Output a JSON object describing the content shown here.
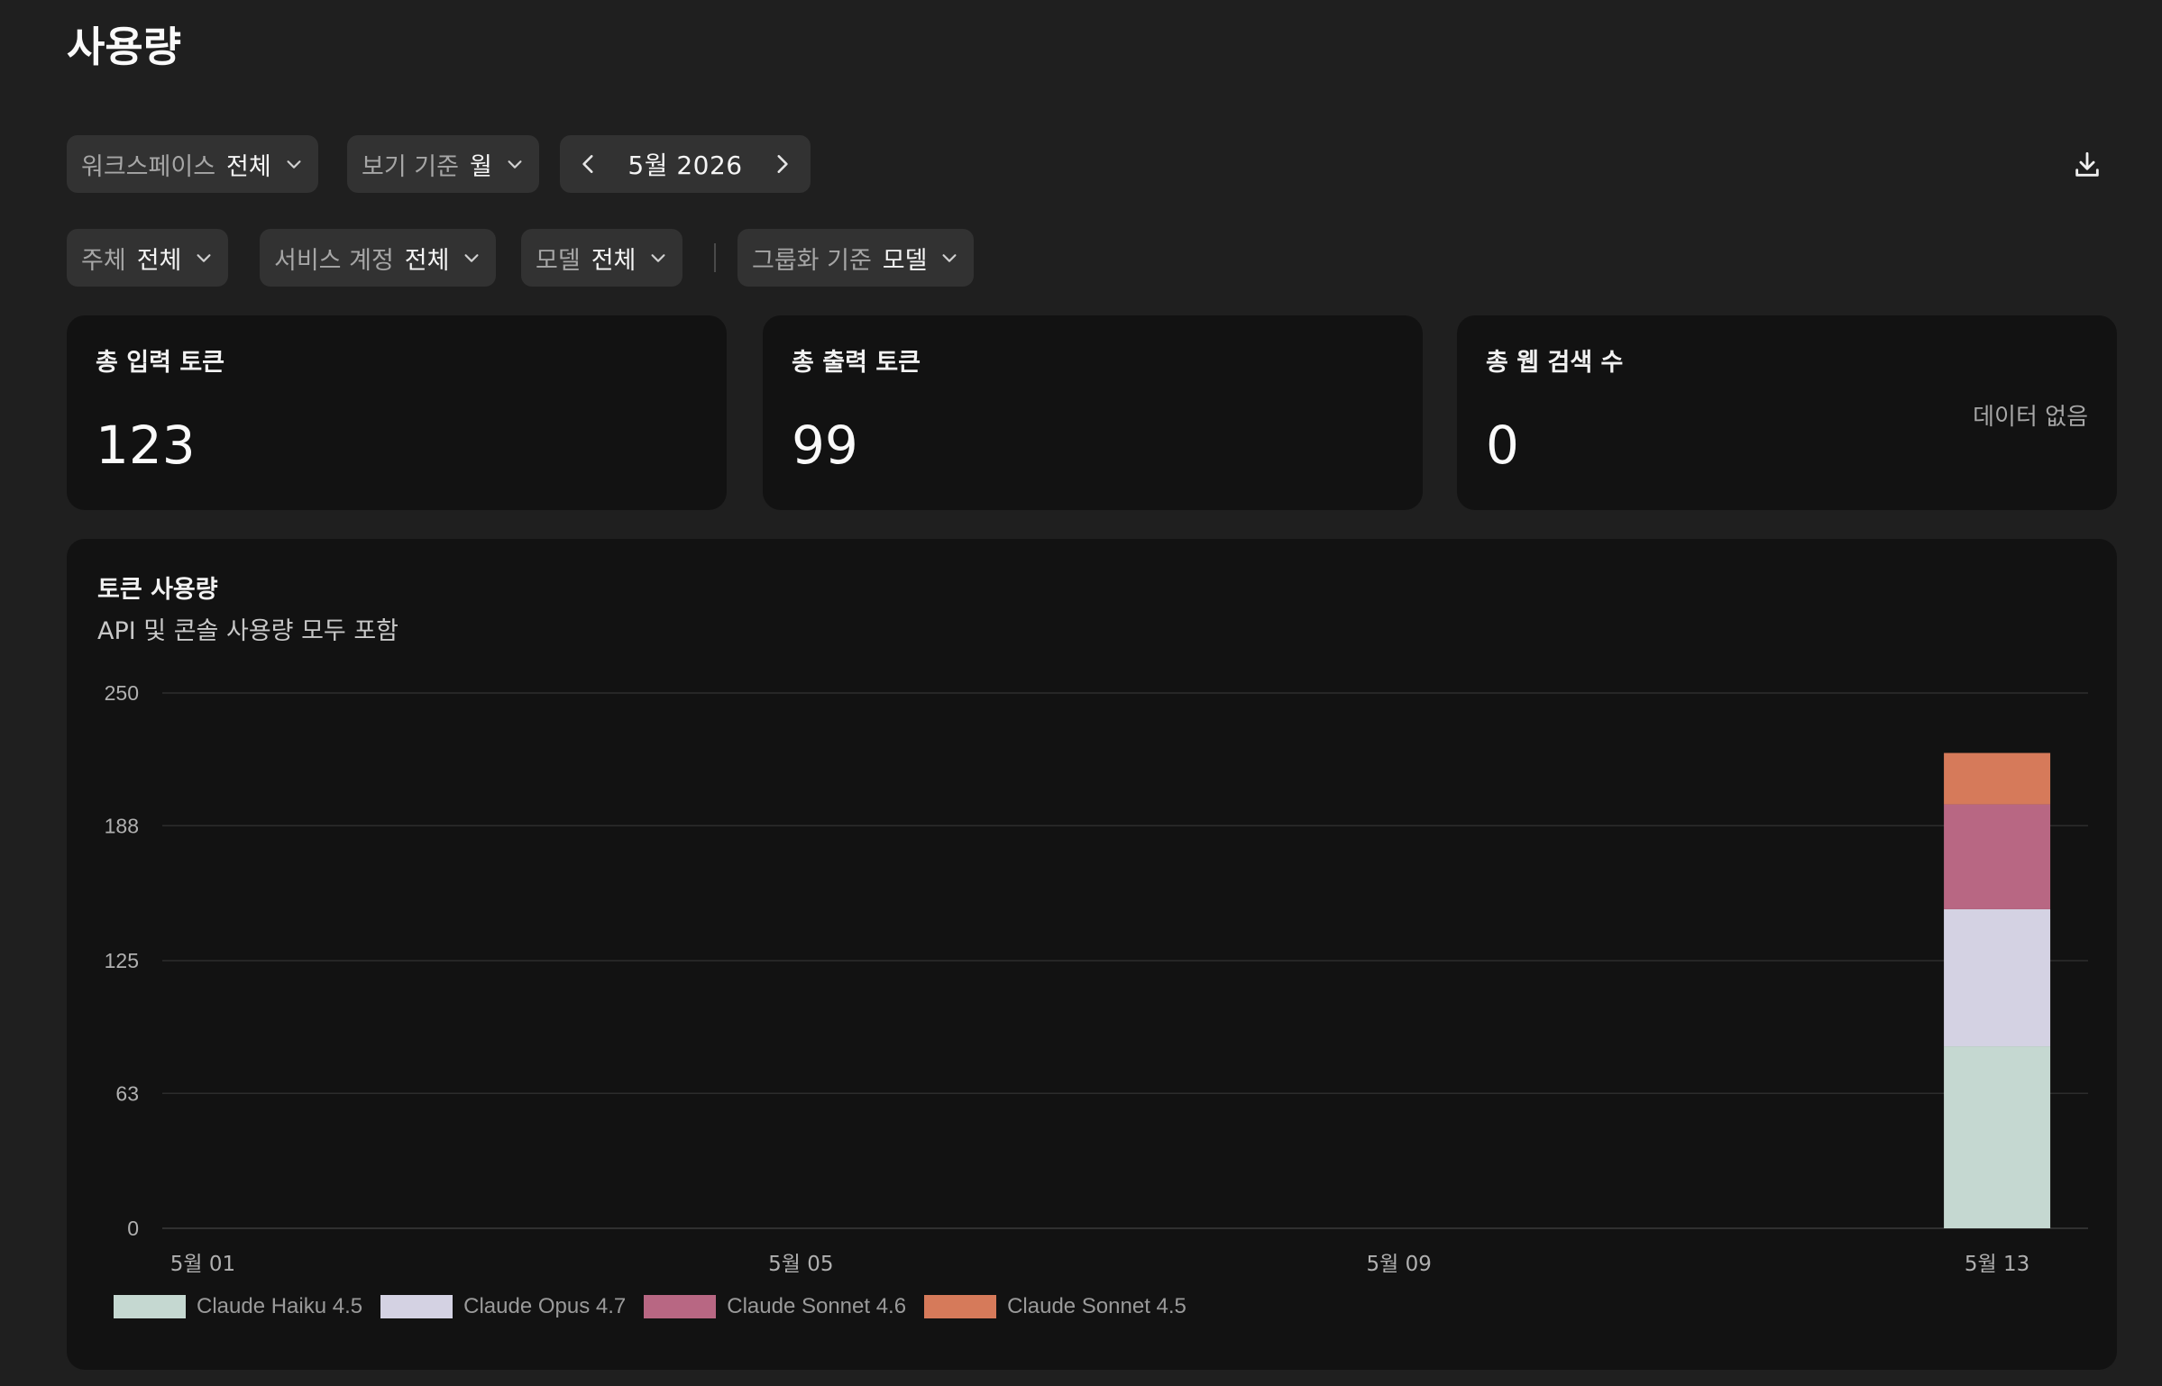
{
  "page": {
    "title": "사용량"
  },
  "filters_row1": {
    "workspace": {
      "label": "워크스페이스",
      "value": "전체"
    },
    "view_by": {
      "label": "보기 기준",
      "value": "월"
    },
    "period": {
      "value": "5월 2026"
    }
  },
  "filters_row2": {
    "subject": {
      "label": "주체",
      "value": "전체"
    },
    "service_account": {
      "label": "서비스 계정",
      "value": "전체"
    },
    "model": {
      "label": "모델",
      "value": "전체"
    },
    "group_by": {
      "label": "그룹화 기준",
      "value": "모델"
    }
  },
  "cards": [
    {
      "title": "총 입력 토큰",
      "value": "123"
    },
    {
      "title": "총 출력 토큰",
      "value": "99"
    },
    {
      "title": "총 웹 검색 수",
      "value": "0",
      "note": "데이터 없음"
    }
  ],
  "chart": {
    "title": "토큰 사용량",
    "subtitle": "API 및 콘솔 사용량 모두 포함"
  },
  "colors": {
    "background": "#1f1f1f",
    "card": "#121212",
    "pill": "#323232"
  },
  "chart_data": {
    "type": "bar",
    "stacked": true,
    "title": "토큰 사용량",
    "subtitle": "API 및 콘솔 사용량 모두 포함",
    "xlabel": "",
    "ylabel": "",
    "ylim": [
      0,
      250
    ],
    "yticks": [
      "0",
      "63",
      "125",
      "188",
      "250"
    ],
    "yticks_values": [
      0,
      63,
      125,
      188,
      250
    ],
    "categories": [
      "5월 01",
      "5월 02",
      "5월 03",
      "5월 04",
      "5월 05",
      "5월 06",
      "5월 07",
      "5월 08",
      "5월 09",
      "5월 10",
      "5월 11",
      "5월 12",
      "5월 13"
    ],
    "xtick_labels": [
      "5월 01",
      "5월 05",
      "5월 09",
      "5월 13"
    ],
    "xtick_indices": [
      0,
      4,
      8,
      12
    ],
    "grid": true,
    "legend_position": "bottom-left",
    "series": [
      {
        "name": "Claude Haiku 4.5",
        "color": "#c5d8d1",
        "values": [
          0,
          0,
          0,
          0,
          0,
          0,
          0,
          0,
          0,
          0,
          0,
          0,
          85
        ]
      },
      {
        "name": "Claude Opus 4.7",
        "color": "#d4d2e3",
        "values": [
          0,
          0,
          0,
          0,
          0,
          0,
          0,
          0,
          0,
          0,
          0,
          0,
          64
        ]
      },
      {
        "name": "Claude Sonnet 4.6",
        "color": "#b86783",
        "values": [
          0,
          0,
          0,
          0,
          0,
          0,
          0,
          0,
          0,
          0,
          0,
          0,
          49
        ]
      },
      {
        "name": "Claude Sonnet 4.5",
        "color": "#d67a5a",
        "values": [
          0,
          0,
          0,
          0,
          0,
          0,
          0,
          0,
          0,
          0,
          0,
          0,
          24
        ]
      }
    ]
  }
}
